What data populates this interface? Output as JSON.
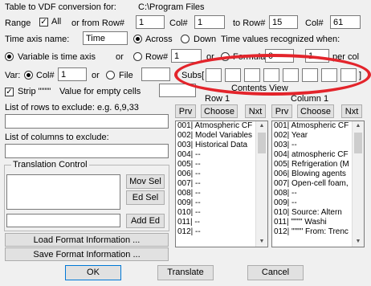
{
  "header": {
    "title": "Table to VDF conversion for:",
    "path": "C:\\Program Files"
  },
  "range": {
    "label": "Range",
    "all_label": "All",
    "from_label": "or from Row#",
    "row_from": "1",
    "col_label": "Col#",
    "col_from": "1",
    "to_row_label": "to Row#",
    "row_to": "15",
    "col_to_label": "Col#",
    "col_to": "61"
  },
  "time_axis": {
    "label": "Time axis name:",
    "value": "Time",
    "across_label": "Across",
    "down_label": "Down",
    "recognized_label": "Time values recognized when:"
  },
  "variable": {
    "label": "Variable is time axis",
    "or_label": "or",
    "row_label": "Row#",
    "row_value": "1",
    "or2_label": "or",
    "formula_label": "Formula",
    "formula_value": "0",
    "per_col_value": "1",
    "per_col_label": "per col"
  },
  "var": {
    "label": "Var:",
    "col_label": "Col#",
    "col_value": "1",
    "or_label": "or",
    "file_label": "File",
    "subs_label": "Subs["
  },
  "strip": {
    "label": "Strip \"\"\"\"",
    "empty_label": "Value for empty cells",
    "contents_label": "Contents View"
  },
  "row1": {
    "title": "Row 1",
    "prv": "Prv",
    "choose": "Choose",
    "nxt": "Nxt",
    "items": [
      "001| Atmospheric CF",
      "002| Model Variables",
      "003| Historical Data",
      "004| --",
      "005| --",
      "006| --",
      "007| --",
      "008| --",
      "009| --",
      "010| --",
      "011| --",
      "012| --"
    ]
  },
  "column1": {
    "title": "Column 1",
    "prv": "Prv",
    "choose": "Choose",
    "nxt": "Nxt",
    "items": [
      "001| Atmospheric CF",
      "002| Year",
      "003| --",
      "004| atmospheric CF",
      "005| Refrigeration (M",
      "006| Blowing agents",
      "007| Open-cell foam,",
      "008| --",
      "009| --",
      "010|  Source: Altern",
      "011| \"\"\"\"      Washi",
      "012| \"\"\"\"  From: Trenc"
    ]
  },
  "exclude": {
    "rows_label": "List of rows to exclude: e.g. 6,9,33",
    "cols_label": "List of columns to exclude:"
  },
  "translation": {
    "title": "Translation Control",
    "mov_sel": "Mov Sel",
    "ed_sel": "Ed Sel",
    "add_ed": "Add Ed"
  },
  "buttons": {
    "load": "Load Format Information ...",
    "save": "Save Format Information ...",
    "ok": "OK",
    "translate": "Translate",
    "cancel": "Cancel"
  }
}
